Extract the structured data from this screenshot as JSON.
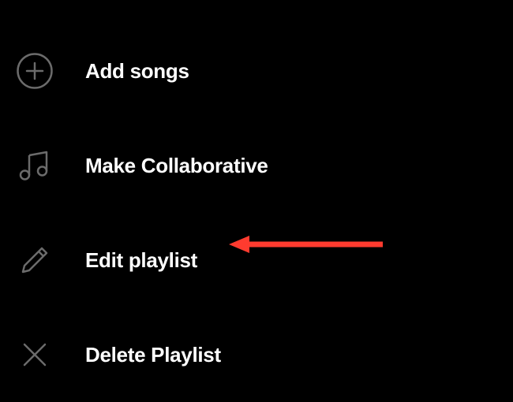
{
  "menu": {
    "items": [
      {
        "label": "Add songs",
        "icon": "plus-circle-icon"
      },
      {
        "label": "Make Collaborative",
        "icon": "music-note-icon"
      },
      {
        "label": "Edit playlist",
        "icon": "pencil-icon"
      },
      {
        "label": "Delete Playlist",
        "icon": "x-icon"
      }
    ]
  },
  "annotation": {
    "color": "#FF3B2F"
  }
}
